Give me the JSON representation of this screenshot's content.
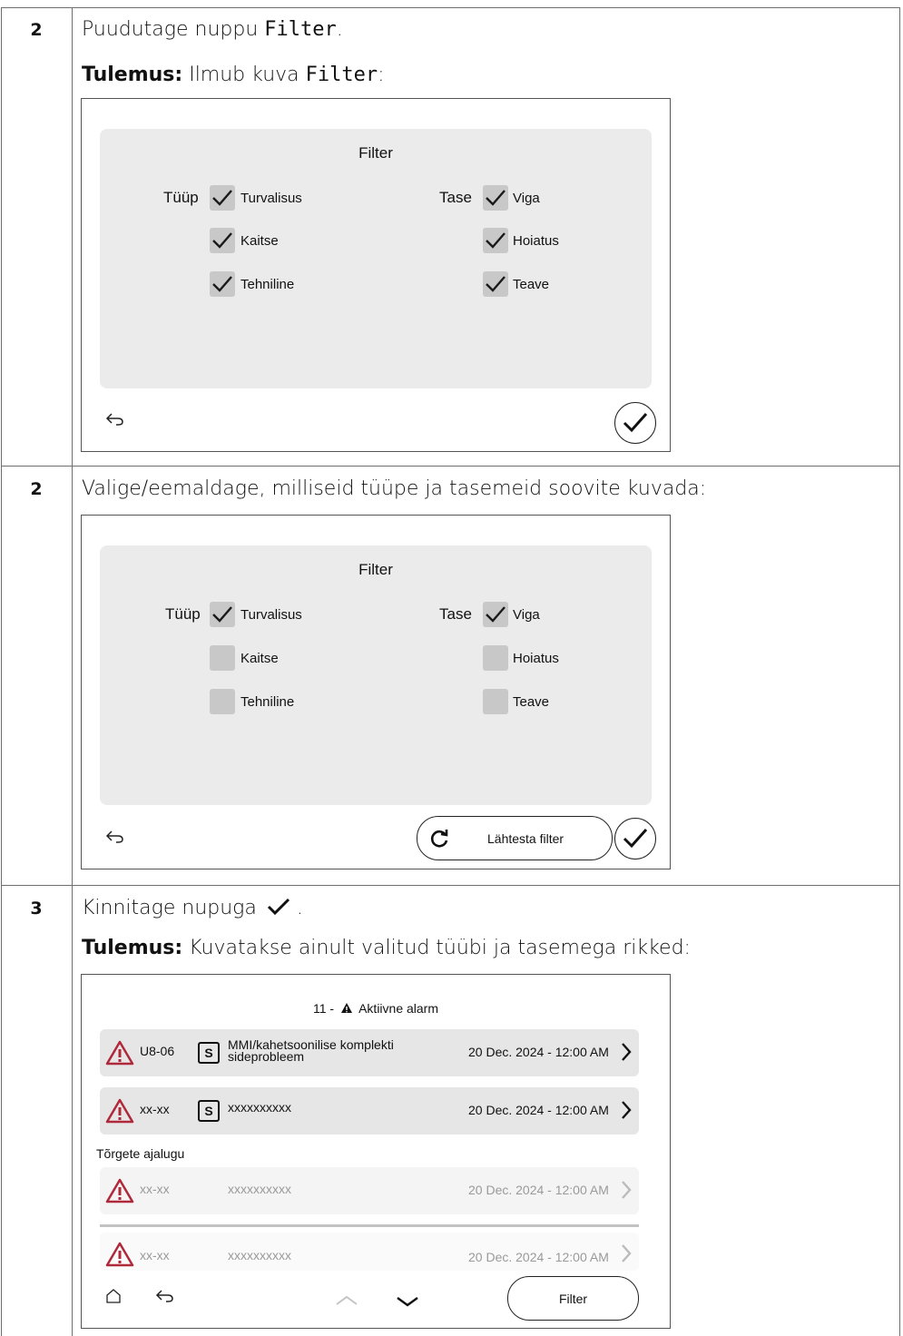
{
  "steps": [
    {
      "number": "2",
      "instruction_prefix": "Puudutage nuppu",
      "instruction_code": "Filter",
      "instruction_suffix": ".",
      "result_label": "Tulemus:",
      "result_text": "Ilmub kuva",
      "result_code": "Filter",
      "result_suffix": ":",
      "screen": {
        "title": "Filter",
        "type_label": "Tüüp",
        "level_label": "Tase",
        "types": [
          {
            "label": "Turvalisus",
            "checked": true
          },
          {
            "label": "Kaitse",
            "checked": true
          },
          {
            "label": "Tehniline",
            "checked": true
          }
        ],
        "levels": [
          {
            "label": "Viga",
            "checked": true
          },
          {
            "label": "Hoiatus",
            "checked": true
          },
          {
            "label": "Teave",
            "checked": true
          }
        ],
        "icons": [
          "back-arrow-icon",
          "checkmark-icon"
        ]
      }
    },
    {
      "number": "2",
      "instruction": "Valige/eemaldage, milliseid tüüpe ja tasemeid soovite kuvada:",
      "screen": {
        "title": "Filter",
        "type_label": "Tüüp",
        "level_label": "Tase",
        "types": [
          {
            "label": "Turvalisus",
            "checked": true
          },
          {
            "label": "Kaitse",
            "checked": false
          },
          {
            "label": "Tehniline",
            "checked": false
          }
        ],
        "levels": [
          {
            "label": "Viga",
            "checked": true
          },
          {
            "label": "Hoiatus",
            "checked": false
          },
          {
            "label": "Teave",
            "checked": false
          }
        ],
        "reset_label": "Lähtesta filter",
        "icons": [
          "back-arrow-icon",
          "refresh-icon",
          "checkmark-icon"
        ]
      }
    },
    {
      "number": "3",
      "instruction_prefix": "Kinnitage nupuga",
      "instruction_suffix": ".",
      "result_label": "Tulemus:",
      "result_text": "Kuvatakse ainult valitud tüübi ja tasemega rikked:",
      "screen": {
        "header_count": "11 -",
        "header_text": "Aktiivne alarm",
        "active": [
          {
            "code": "U8-06",
            "badge": "S",
            "desc_line1": "MMI/kahetsoonilise komplekti",
            "desc_line2": "sideprobleem",
            "date": "20 Dec. 2024 - 12:00 AM"
          },
          {
            "code": "xx-xx",
            "badge": "S",
            "desc_line1": "xxxxxxxxxx",
            "desc_line2": "",
            "date": "20 Dec. 2024 - 12:00 AM"
          }
        ],
        "history_label": "Tõrgete ajalugu",
        "history": [
          {
            "code": "xx-xx",
            "desc": "xxxxxxxxxx",
            "date": "20 Dec. 2024 - 12:00 AM"
          },
          {
            "code": "xx-xx",
            "desc": "xxxxxxxxxx",
            "date": "20 Dec. 2024 - 12:00 AM"
          }
        ],
        "filter_label": "Filter",
        "icons": [
          "home-icon",
          "back-arrow-icon",
          "chevron-up-icon",
          "chevron-down-icon",
          "warning-triangle-icon"
        ],
        "colors": {
          "warning": "#b0293a"
        }
      }
    }
  ]
}
